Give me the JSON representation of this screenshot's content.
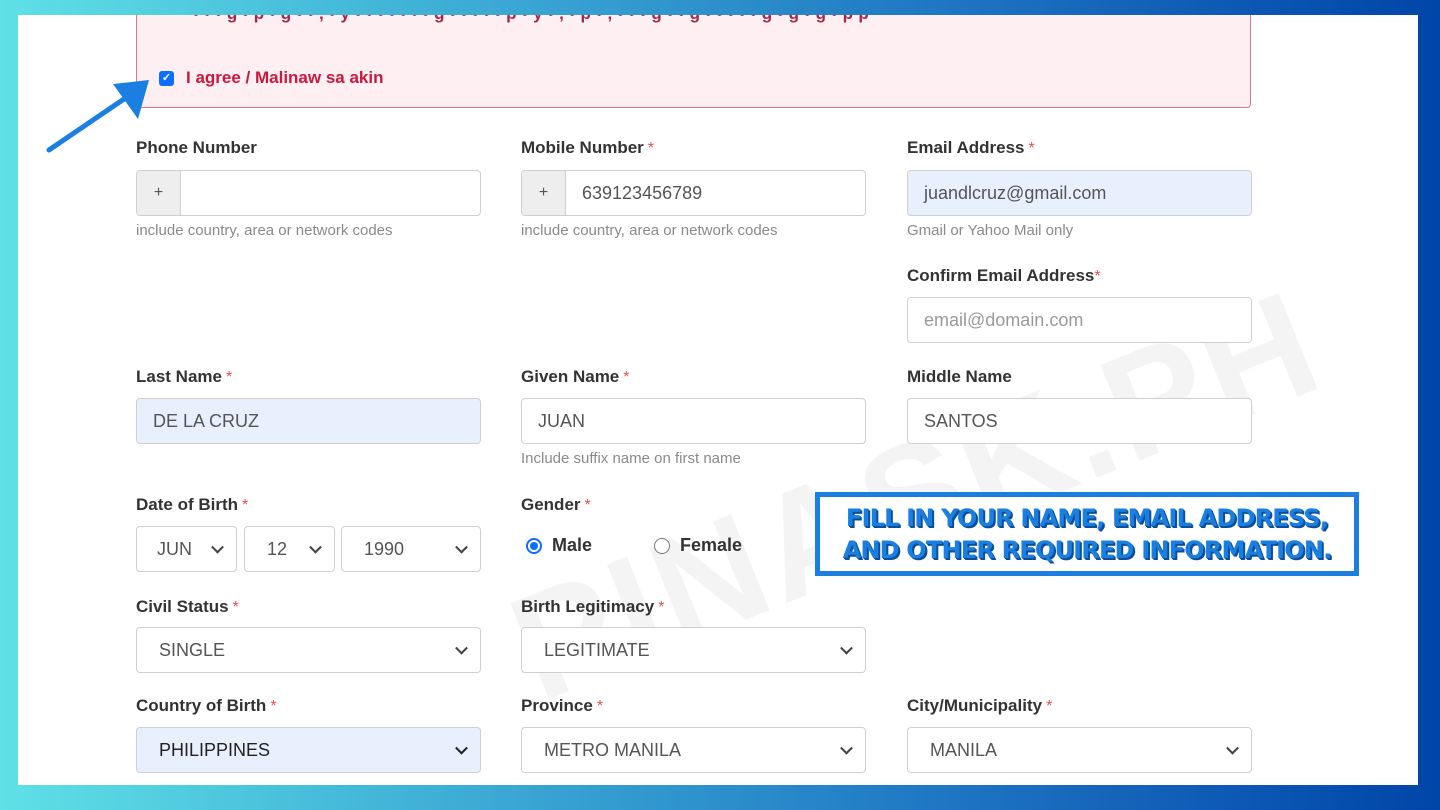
{
  "consent": {
    "truncated_text": "• • • g • p • g • • , • y • • • • • • • g • • • • • p • y • , • p • , • • • g • • g • • • • • g • g • g • p p",
    "agree_checked": true,
    "agree_label": "I agree / Malinaw sa akin"
  },
  "watermark": "PINASK.PH",
  "callout": {
    "line1": "FILL IN YOUR NAME, EMAIL ADDRESS,",
    "line2": "AND OTHER REQUIRED INFORMATION."
  },
  "colors": {
    "accent": "#1a7fe0",
    "required": "#d9534f",
    "alert_text": "#c8193f",
    "autofill_bg": "#e8f0fe"
  },
  "form": {
    "required_mark": "*",
    "phone": {
      "label": "Phone Number",
      "prefix": "+",
      "value": "",
      "help": "include country, area or network codes"
    },
    "mobile": {
      "label": "Mobile Number",
      "prefix": "+",
      "value": "639123456789",
      "help": "include country, area or network codes"
    },
    "email": {
      "label": "Email Address",
      "value": "juandlcruz@gmail.com",
      "help": "Gmail or Yahoo Mail only"
    },
    "confirm_email": {
      "label": "Confirm Email Address",
      "placeholder": "email@domain.com"
    },
    "last_name": {
      "label": "Last Name",
      "value": "DE LA CRUZ"
    },
    "given_name": {
      "label": "Given Name",
      "value": "JUAN",
      "help": "Include suffix name on first name"
    },
    "middle_name": {
      "label": "Middle Name",
      "value": "SANTOS"
    },
    "dob": {
      "label": "Date of Birth",
      "month": "JUN",
      "day": "12",
      "year": "1990"
    },
    "gender": {
      "label": "Gender",
      "options": [
        {
          "label": "Male",
          "selected": true
        },
        {
          "label": "Female",
          "selected": false
        }
      ]
    },
    "civil_status": {
      "label": "Civil Status",
      "value": "SINGLE"
    },
    "birth_legitimacy": {
      "label": "Birth Legitimacy",
      "value": "LEGITIMATE"
    },
    "country_of_birth": {
      "label": "Country of Birth",
      "value": "PHILIPPINES"
    },
    "province": {
      "label": "Province",
      "value": "METRO MANILA"
    },
    "city": {
      "label": "City/Municipality",
      "value": "MANILA"
    }
  }
}
